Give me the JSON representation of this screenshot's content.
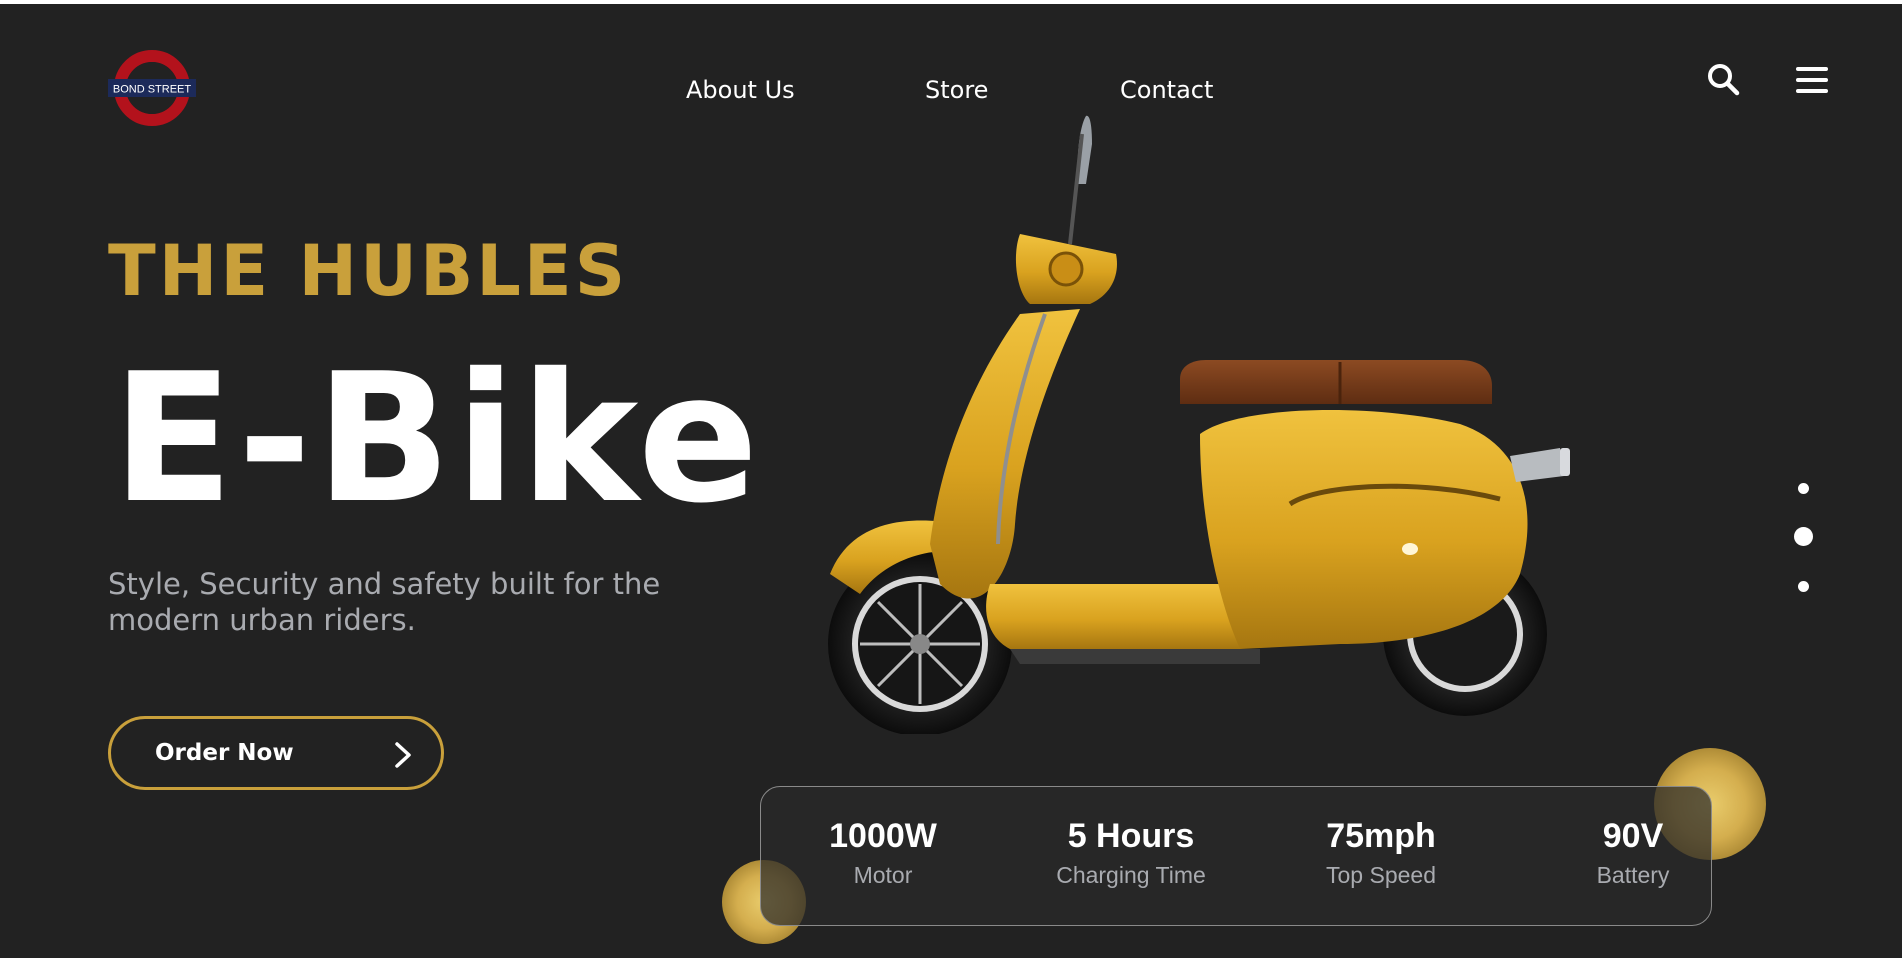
{
  "header": {
    "logo_text": "BOND STREET",
    "nav": [
      {
        "label": "About Us"
      },
      {
        "label": "Store"
      },
      {
        "label": "Contact"
      }
    ],
    "icons": {
      "search": "search-icon",
      "menu": "hamburger-menu-icon"
    }
  },
  "hero": {
    "brand": "THE HUBLES",
    "title": "E-Bike",
    "tagline": "Style, Security and safety built for the modern urban riders.",
    "cta_label": "Order Now"
  },
  "stats": [
    {
      "value": "1000W",
      "label": "Motor"
    },
    {
      "value": "5 Hours",
      "label": "Charging Time"
    },
    {
      "value": "75mph",
      "label": "Top Speed"
    },
    {
      "value": "90V",
      "label": "Battery"
    }
  ],
  "slider": {
    "dots": 3,
    "active": 2
  },
  "colors": {
    "background": "#222222",
    "accent": "#c9a03b",
    "text": "#ffffff",
    "muted": "#a9abb0",
    "logo_red": "#b3121c",
    "logo_navy": "#1c2a5a"
  }
}
